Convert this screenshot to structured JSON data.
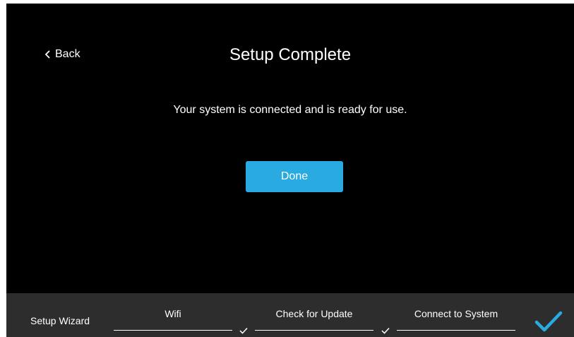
{
  "header": {
    "back_label": "Back",
    "title": "Setup Complete"
  },
  "main": {
    "message": "Your system is connected and is ready for use.",
    "done_label": "Done"
  },
  "footer": {
    "wizard_label": "Setup Wizard",
    "steps": [
      {
        "label": "Wifi",
        "completed": true
      },
      {
        "label": "Check for Update",
        "completed": true
      },
      {
        "label": "Connect to System",
        "completed": true
      }
    ],
    "final_icon": "checkmark-icon"
  },
  "colors": {
    "background": "#000000",
    "accent": "#29abe2",
    "footer": "#2d2d2d",
    "text": "#ffffff"
  }
}
